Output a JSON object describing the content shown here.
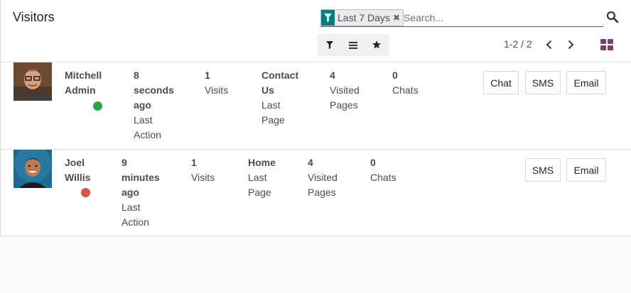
{
  "header": {
    "title": "Visitors",
    "search": {
      "facet_label": "Last 7 Days",
      "placeholder": "Search...",
      "facet_icon": "filter-icon",
      "remove_icon": "close-icon",
      "search_icon": "search-icon"
    },
    "toolbar": {
      "filter_icon": "filter-icon",
      "groupby_icon": "list-icon",
      "favorite_icon": "star-icon"
    },
    "pager": {
      "value": "1-2 / 2"
    },
    "view_switch_icon": "kanban-icon"
  },
  "colors": {
    "accent": "#017e84",
    "online": "#28a745",
    "offline": "#d9534f",
    "switch": "#71426a"
  },
  "visitors": [
    {
      "name_line1": "Mitchell",
      "name_line2": "Admin",
      "status": "online",
      "action_line1": "8",
      "action_line2": "seconds",
      "action_line3": "ago",
      "action_label_line1": "Last",
      "action_label_line2": "Action",
      "visits_count": "1",
      "visits_label": "Visits",
      "page_line1": "Contact",
      "page_line2": "Us",
      "page_label_line1": "Last",
      "page_label_line2": "Page",
      "visited_count": "4",
      "visited_label_line1": "Visited",
      "visited_label_line2": "Pages",
      "chats_count": "0",
      "chats_label": "Chats",
      "chat_button": "Chat",
      "sms_button": "SMS",
      "email_button": "Email"
    },
    {
      "name_line1": "Joel",
      "name_line2": "Willis",
      "status": "offline",
      "action_line1": "9",
      "action_line2": "minutes",
      "action_line3": "ago",
      "action_label_line1": "Last",
      "action_label_line2": "Action",
      "visits_count": "1",
      "visits_label": "Visits",
      "page_line1": "Home",
      "page_label_line1": "Last",
      "page_label_line2": "Page",
      "visited_count": "4",
      "visited_label_line1": "Visited",
      "visited_label_line2": "Pages",
      "chats_count": "0",
      "chats_label": "Chats",
      "sms_button": "SMS",
      "email_button": "Email"
    }
  ]
}
